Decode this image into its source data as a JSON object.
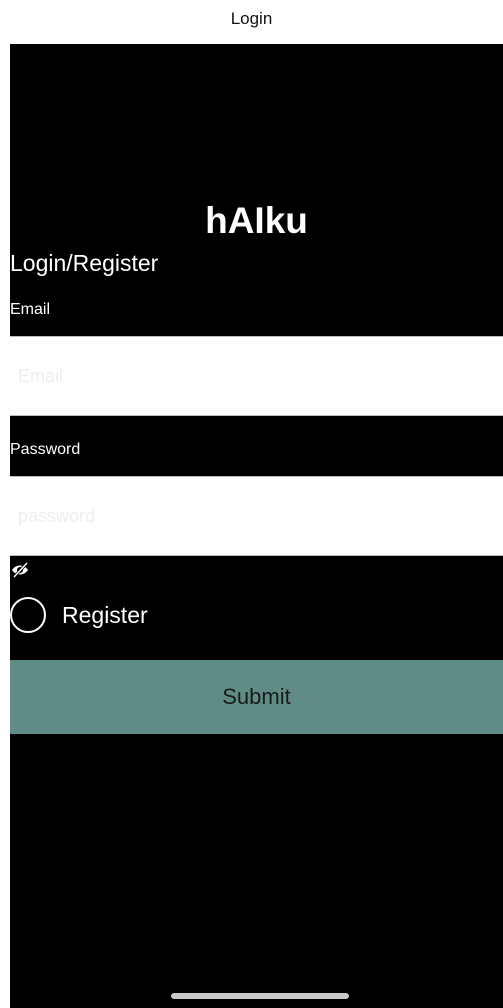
{
  "nav": {
    "title": "Login"
  },
  "app": {
    "title": "hAIku"
  },
  "form": {
    "heading": "Login/Register",
    "email_label": "Email",
    "email_placeholder": "Email",
    "email_value": "",
    "password_label": "Password",
    "password_placeholder": "password",
    "password_value": "",
    "show_password_icon": "eye-slash-icon",
    "register_label": "Register",
    "register_checked": false,
    "submit_label": "Submit"
  },
  "colors": {
    "background": "#000000",
    "accent": "#5f8c84",
    "input_background": "#ffffff"
  }
}
